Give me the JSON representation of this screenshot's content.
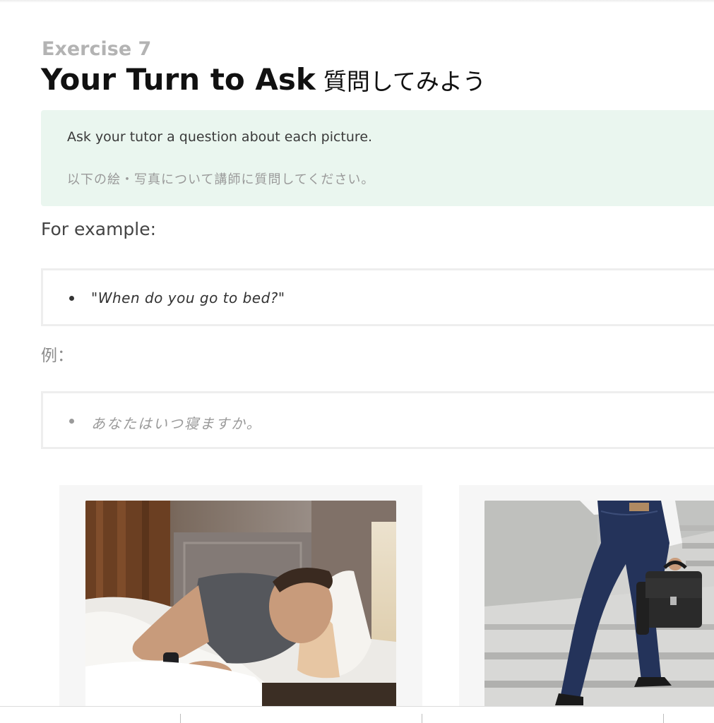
{
  "exercise": {
    "label": "Exercise 7",
    "title_en": "Your Turn to Ask",
    "title_ja": "質問してみよう"
  },
  "instructions": {
    "en": "Ask your tutor a question about each picture.",
    "ja": "以下の絵・写真について講師に質問してください。"
  },
  "examples": {
    "heading_en": "For example:",
    "item_en": "\"When do you go to bed?\"",
    "heading_ja": "例：",
    "item_ja": "あなたはいつ寝ますか。"
  },
  "pictures": [
    {
      "icon": "photo-man-sleeping-in-bed"
    },
    {
      "icon": "photo-man-walking-up-stairs-with-briefcase"
    }
  ],
  "colors": {
    "instruction_bg": "#eaf6ef",
    "muted_text": "#9a9a9a",
    "exercise_label": "#b3b3b3"
  }
}
